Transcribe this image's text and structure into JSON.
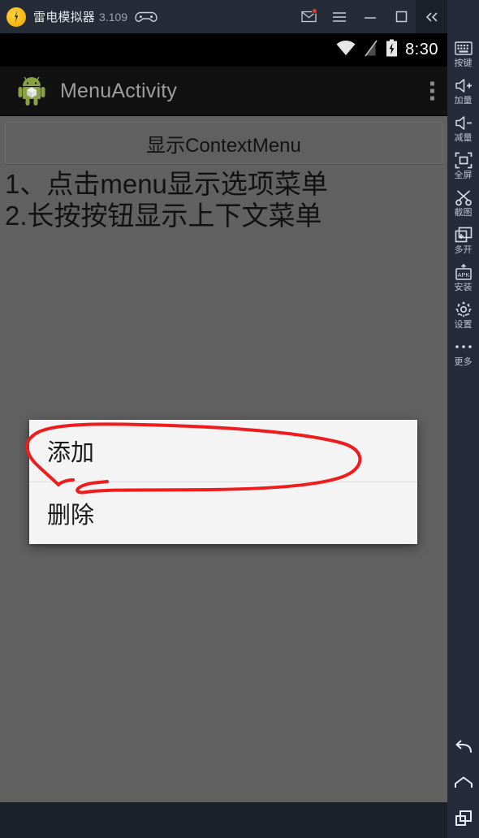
{
  "titlebar": {
    "app_name": "雷电模拟器",
    "version": "3.109",
    "icons": {
      "logo": "ldplayer-logo-icon",
      "gamepad": "gamepad-icon",
      "mail": "mail-icon",
      "menu": "hamburger-menu-icon",
      "minimize": "minimize-icon",
      "maximize": "maximize-icon",
      "close": "close-icon",
      "collapse": "double-chevron-left-icon"
    },
    "badge_color": "#f03a20"
  },
  "statusbar": {
    "time": "8:30",
    "wifi": "wifi-icon",
    "signal": "no-sim-signal-icon",
    "battery": "battery-charging-icon"
  },
  "appbar": {
    "title": "MenuActivity",
    "app_icon": "android-robot-icon",
    "overflow": "overflow-menu-icon"
  },
  "main": {
    "button_label": "显示ContextMenu",
    "hint_line1": "1、点击menu显示选项菜单",
    "hint_line2": "2.长按按钮显示上下文菜单",
    "background_color": "#616161"
  },
  "context_menu": {
    "items": [
      {
        "label": "添加"
      },
      {
        "label": "删除"
      }
    ]
  },
  "annotation": {
    "type": "hand-drawn-ellipse",
    "color": "#ee1c1c",
    "target": "添加"
  },
  "sidebar": {
    "background_color": "#252b3a",
    "items": [
      {
        "label": "按键",
        "icon": "keyboard-icon"
      },
      {
        "label": "加量",
        "icon": "volume-up-icon"
      },
      {
        "label": "减量",
        "icon": "volume-down-icon"
      },
      {
        "label": "全屏",
        "icon": "fullscreen-icon"
      },
      {
        "label": "截图",
        "icon": "scissors-screenshot-icon"
      },
      {
        "label": "多开",
        "icon": "multi-instance-icon"
      },
      {
        "label": "安装",
        "icon": "apk-install-icon"
      },
      {
        "label": "设置",
        "icon": "gear-settings-icon"
      },
      {
        "label": "更多",
        "icon": "more-dots-icon"
      }
    ],
    "nav": [
      {
        "icon": "back-arrow-icon"
      },
      {
        "icon": "home-icon"
      },
      {
        "icon": "recents-icon"
      }
    ]
  }
}
